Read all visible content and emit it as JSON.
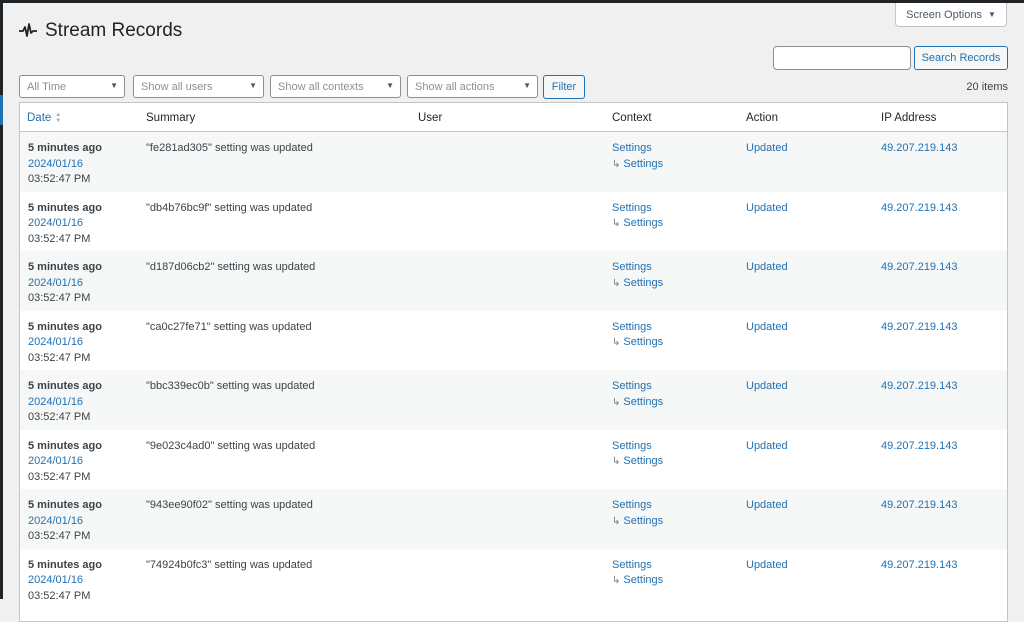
{
  "header": {
    "title": "Stream Records",
    "screen_options": "Screen Options"
  },
  "search": {
    "value": "",
    "button": "Search Records"
  },
  "filters": {
    "time": "All Time",
    "users": "Show all users",
    "contexts": "Show all contexts",
    "actions": "Show all actions",
    "button": "Filter"
  },
  "items_count": "20 items",
  "columns": {
    "date": "Date",
    "summary": "Summary",
    "user": "User",
    "context": "Context",
    "action": "Action",
    "ip": "IP Address"
  },
  "rows": [
    {
      "rel": "5 minutes ago",
      "date": "2024/01/16",
      "time": "03:52:47 PM",
      "summary": "\"fe281ad305\" setting was updated",
      "context": "Settings",
      "sub_context": "Settings",
      "action": "Updated",
      "ip": "49.207.219.143"
    },
    {
      "rel": "5 minutes ago",
      "date": "2024/01/16",
      "time": "03:52:47 PM",
      "summary": "\"db4b76bc9f\" setting was updated",
      "context": "Settings",
      "sub_context": "Settings",
      "action": "Updated",
      "ip": "49.207.219.143"
    },
    {
      "rel": "5 minutes ago",
      "date": "2024/01/16",
      "time": "03:52:47 PM",
      "summary": "\"d187d06cb2\" setting was updated",
      "context": "Settings",
      "sub_context": "Settings",
      "action": "Updated",
      "ip": "49.207.219.143"
    },
    {
      "rel": "5 minutes ago",
      "date": "2024/01/16",
      "time": "03:52:47 PM",
      "summary": "\"ca0c27fe71\" setting was updated",
      "context": "Settings",
      "sub_context": "Settings",
      "action": "Updated",
      "ip": "49.207.219.143"
    },
    {
      "rel": "5 minutes ago",
      "date": "2024/01/16",
      "time": "03:52:47 PM",
      "summary": "\"bbc339ec0b\" setting was updated",
      "context": "Settings",
      "sub_context": "Settings",
      "action": "Updated",
      "ip": "49.207.219.143"
    },
    {
      "rel": "5 minutes ago",
      "date": "2024/01/16",
      "time": "03:52:47 PM",
      "summary": "\"9e023c4ad0\" setting was updated",
      "context": "Settings",
      "sub_context": "Settings",
      "action": "Updated",
      "ip": "49.207.219.143"
    },
    {
      "rel": "5 minutes ago",
      "date": "2024/01/16",
      "time": "03:52:47 PM",
      "summary": "\"943ee90f02\" setting was updated",
      "context": "Settings",
      "sub_context": "Settings",
      "action": "Updated",
      "ip": "49.207.219.143"
    },
    {
      "rel": "5 minutes ago",
      "date": "2024/01/16",
      "time": "03:52:47 PM",
      "summary": "\"74924b0fc3\" setting was updated",
      "context": "Settings",
      "sub_context": "Settings",
      "action": "Updated",
      "ip": "49.207.219.143"
    }
  ]
}
